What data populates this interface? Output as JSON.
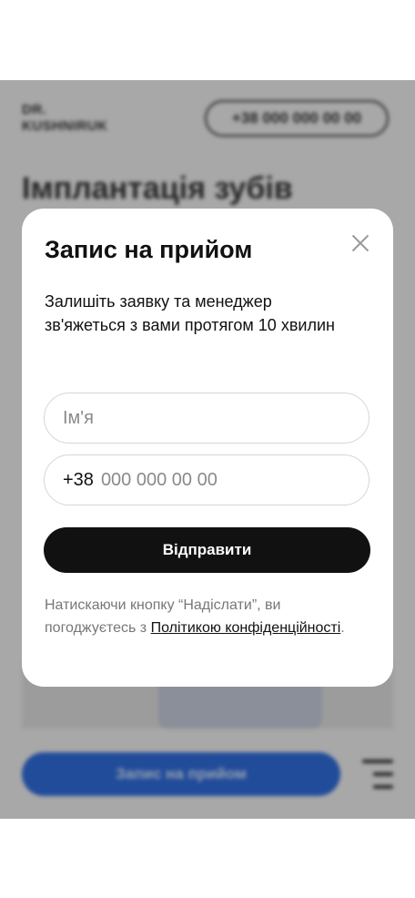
{
  "background": {
    "logo": "DR.\nKUSHNIRUK",
    "phone": "+38 000 000 00 00",
    "title": "Імплантація зубів",
    "cta_label": "Запис на прийом"
  },
  "modal": {
    "title": "Запис на прийом",
    "subtitle": "Залишіть заявку та менеджер зв'яжеться з вами протягом 10 хвилин",
    "name_placeholder": "Ім'я",
    "phone_prefix": "+38",
    "phone_placeholder": "000 000 00 00",
    "submit_label": "Відправити",
    "consent_text": "Натискаючи кнопку “Надіслати”, ви погоджуєтесь з ",
    "consent_link": "Політикою конфіденційності",
    "consent_end": "."
  },
  "colors": {
    "cta_blue": "#2f6ad6",
    "submit_black": "#111111"
  }
}
